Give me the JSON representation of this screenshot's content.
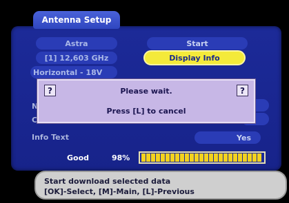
{
  "window": {
    "title": "Antenna Setup"
  },
  "left_column": {
    "satellite": "Astra",
    "frequency": "[1] 12,603 GHz",
    "polarization": "Horizontal - 18V",
    "hidden_row1_partial": "N",
    "hidden_row2_partial": "C",
    "info_text_label": "Info Text"
  },
  "right_column": {
    "start_label": "Start",
    "display_info_label": "Display Info",
    "info_text_value": "Yes"
  },
  "signal": {
    "quality_label": "Good",
    "percent_label": "98%",
    "level_percent": 98
  },
  "dialog": {
    "left_icon": "?",
    "right_icon": "?",
    "line1": "Please wait.",
    "line2": "Press [L] to cancel"
  },
  "status": {
    "line1": "Start download selected data",
    "line2": "[OK]-Select, [M]-Main, [L]-Previous"
  },
  "colors": {
    "panel": "#1c2a98",
    "highlight": "#f4ea3a",
    "bar": "#f3d21e",
    "dialog": "#c7b7e6",
    "status": "#cfcfcf"
  }
}
